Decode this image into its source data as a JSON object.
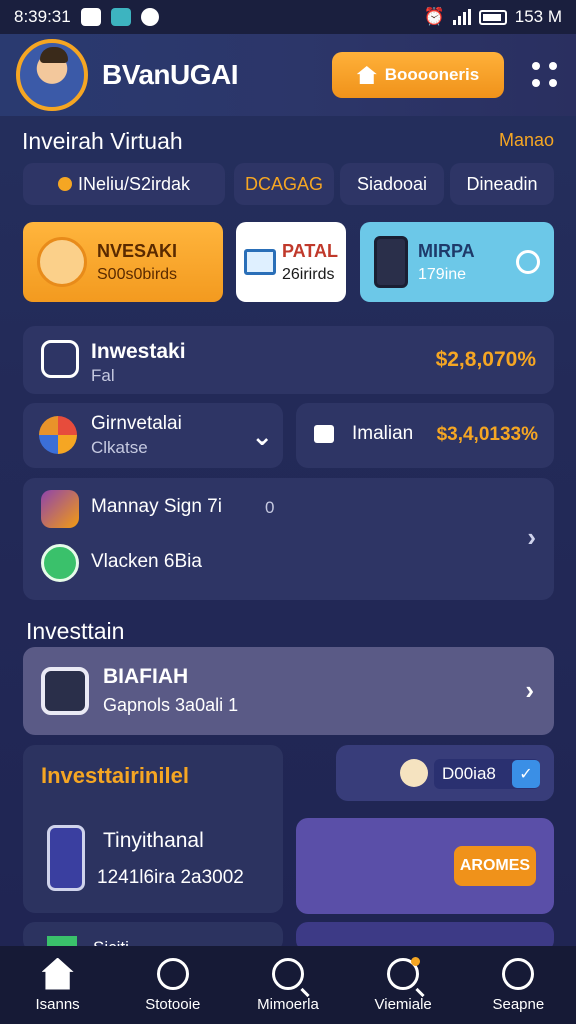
{
  "status": {
    "left_text": "8:39:31",
    "right_text": "153 M"
  },
  "header": {
    "app_title": "BVanUGAI",
    "cta_label": "Booooneris"
  },
  "section1": {
    "title": "Inveirah Virtuah",
    "link": "Manao"
  },
  "chips": [
    "INeliu/S2irdak",
    "DCAGAG",
    "Siadooai",
    "Dineadin"
  ],
  "tiles": [
    {
      "line1": "NVESAKI",
      "line2": "S00s0birds"
    },
    {
      "line1": "PATAL",
      "line2": "26irirds"
    },
    {
      "line1": "MIRPA",
      "line2": "179ine"
    }
  ],
  "cards": {
    "invest": {
      "name": "Inwestaki",
      "sub": "Fal",
      "amount": "$2,8,070%"
    },
    "left": {
      "name": "Girnvetalai",
      "sub": "Clkatse"
    },
    "right": {
      "name": "Imalian",
      "amount": "$3,4,0133%"
    },
    "list": {
      "item1": "Mannay Sign 7i",
      "item1_count": "0",
      "item2": "Vlacken 6Bia"
    }
  },
  "section2": {
    "title": "Investtain"
  },
  "banner": {
    "title": "BIAFIAH",
    "sub": "Gapnols 3a0ali 1"
  },
  "lower": {
    "orange_title": "Investtairinilel",
    "device_title": "Tinyithanal",
    "device_sub": "1241l6ira 2a3002",
    "pill_label": "D00ia8",
    "button_label": "AROMES",
    "peek_label": "Siciti"
  },
  "tabs": [
    "Isanns",
    "Stotooie",
    "Mimoerla",
    "Viemiale",
    "Seapne"
  ],
  "colors": {
    "accent": "#f5a623",
    "background": "#232a58",
    "card": "#2e3565"
  }
}
